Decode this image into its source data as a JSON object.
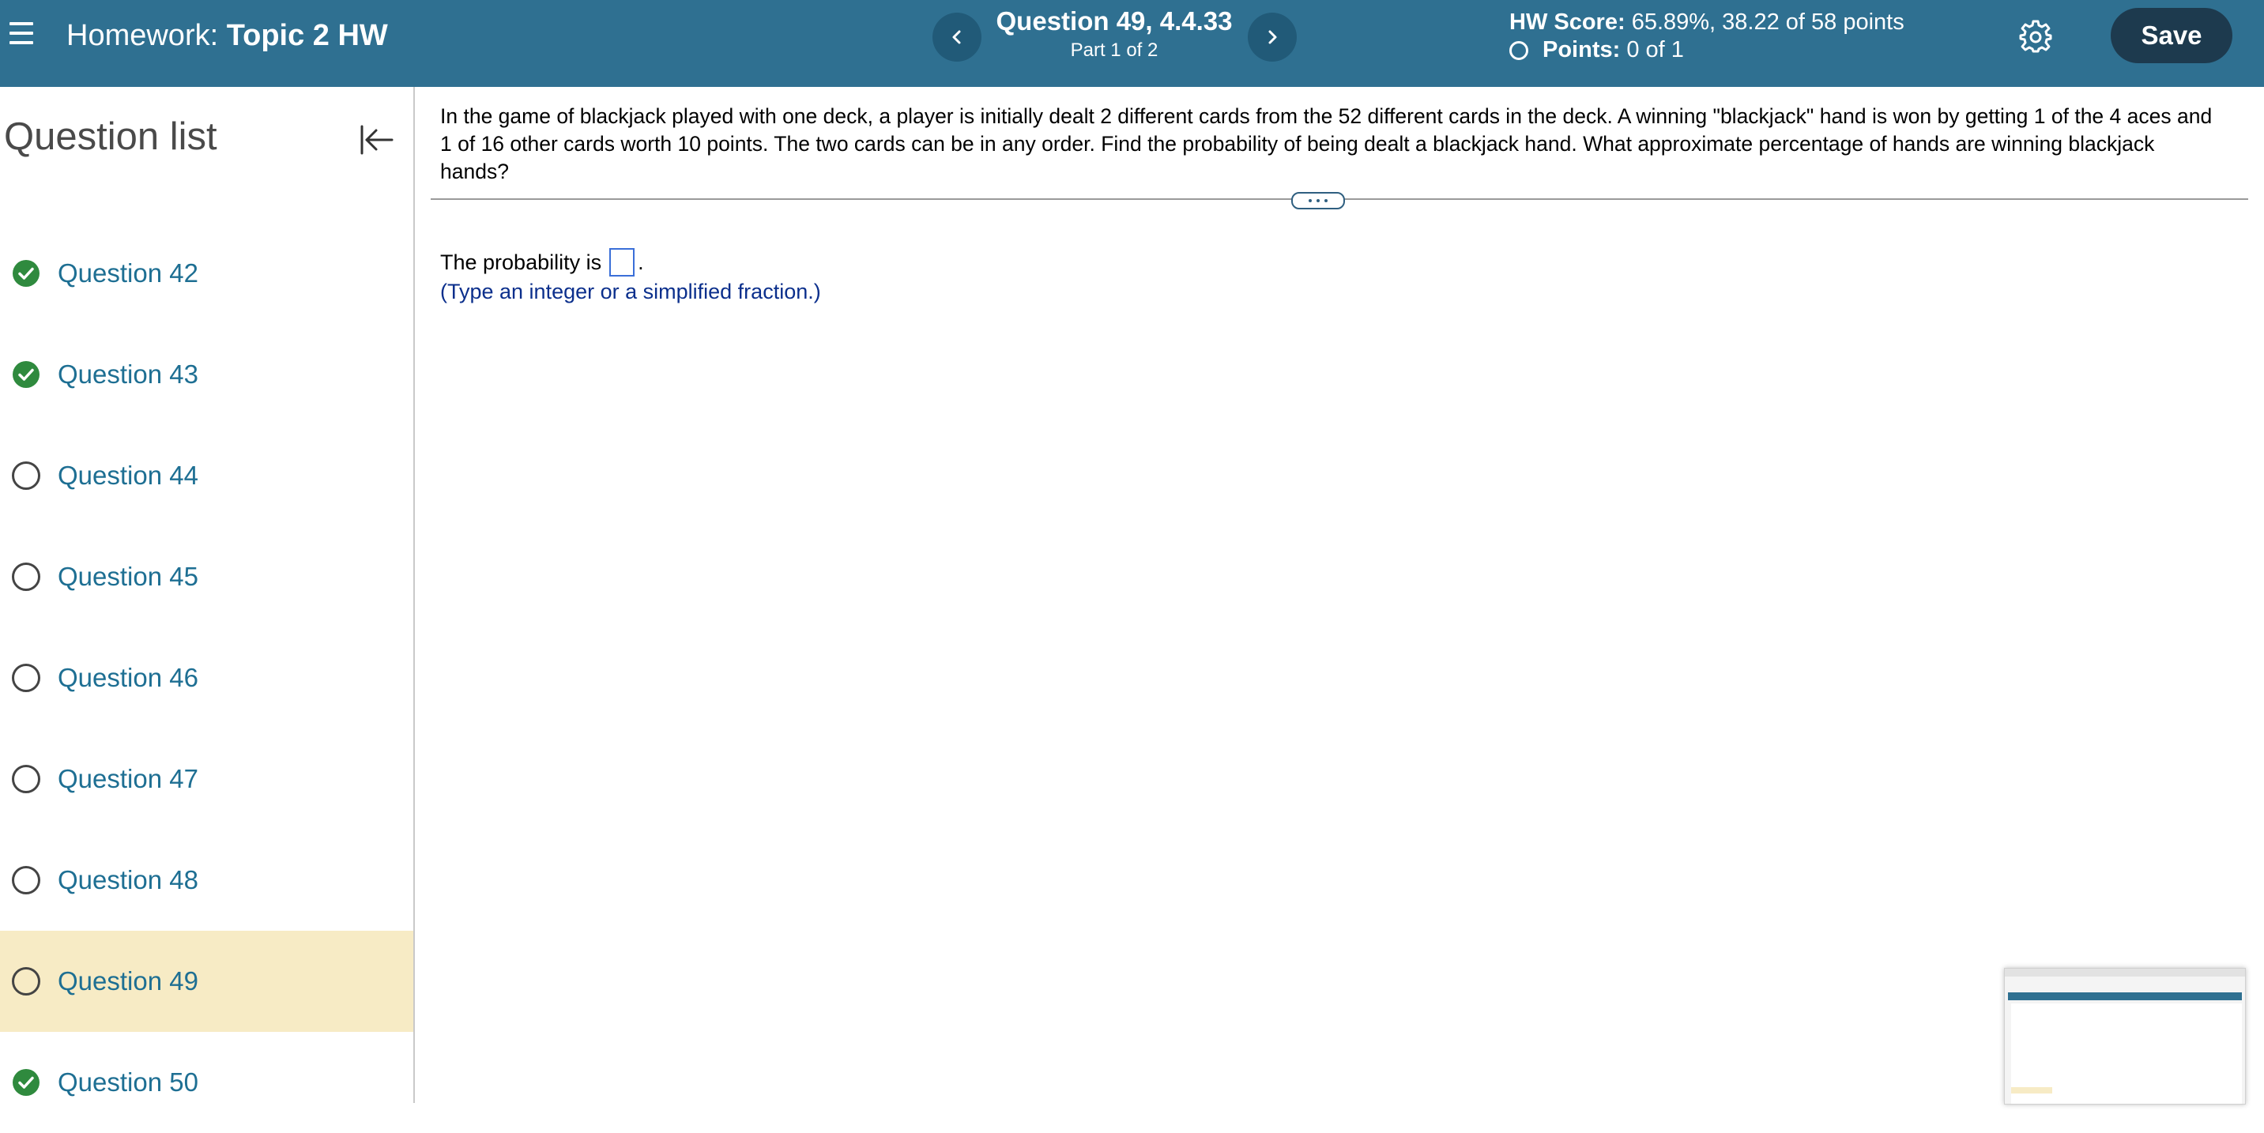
{
  "header": {
    "homework_prefix": "Homework:",
    "homework_name": "Topic 2 HW",
    "question_title": "Question 49, 4.4.33",
    "question_part": "Part 1 of 2",
    "hw_score_label": "HW Score:",
    "hw_score_value": "65.89%, 38.22 of 58 points",
    "points_label": "Points:",
    "points_value": "0 of 1",
    "save_label": "Save",
    "icons": [
      "menu-icon",
      "chevron-left-icon",
      "chevron-right-icon",
      "gear-icon"
    ]
  },
  "sidebar": {
    "title": "Question list",
    "collapse_icon": "collapse-left-icon",
    "items": [
      {
        "label": "Question 42",
        "status": "complete"
      },
      {
        "label": "Question 43",
        "status": "complete"
      },
      {
        "label": "Question 44",
        "status": "open"
      },
      {
        "label": "Question 45",
        "status": "open"
      },
      {
        "label": "Question 46",
        "status": "open"
      },
      {
        "label": "Question 47",
        "status": "open"
      },
      {
        "label": "Question 48",
        "status": "open"
      },
      {
        "label": "Question 49",
        "status": "open",
        "active": true
      },
      {
        "label": "Question 50",
        "status": "complete"
      }
    ]
  },
  "main": {
    "problem_text": "In the game of blackjack played with one deck, a player is initially dealt 2 different cards from the 52 different cards in the deck. A winning \"blackjack\" hand is won by getting 1 of the 4 aces and 1 of 16 other cards worth 10 points. The two cards can be in any order. Find the probability of being dealt a blackjack hand. What approximate percentage of hands are winning blackjack hands?",
    "answer_prefix": "The probability is",
    "answer_value": "",
    "answer_suffix": ".",
    "hint": "(Type an integer or a simplified fraction.)"
  },
  "colors": {
    "header_bg": "#2f7091",
    "save_bg": "#1d3a4e",
    "link": "#1e6f93",
    "complete_green": "#2f8a3e",
    "active_row": "#f7ebc5",
    "hint": "#0b2f8c"
  }
}
